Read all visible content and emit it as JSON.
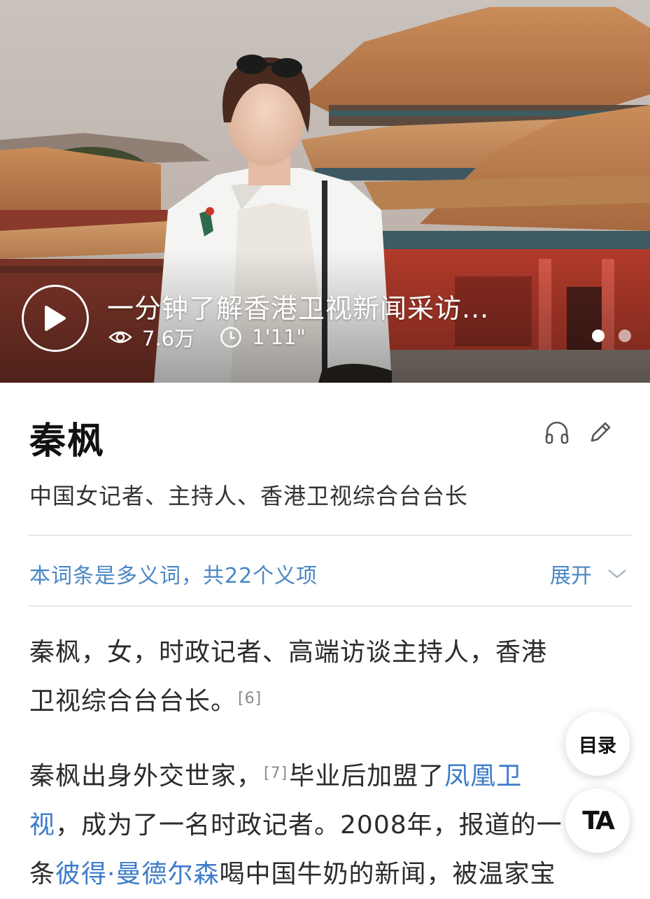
{
  "video": {
    "title": "一分钟了解香港卫视新闻采访...",
    "views": "7.6万",
    "duration": "1'11\"",
    "slide_count": 2,
    "active_slide": 1
  },
  "entry": {
    "title": "秦枫",
    "subtitle": "中国女记者、主持人、香港卫视综合台台长",
    "polysemy_text": "本词条是多义词，共22个义项",
    "expand_label": "展开"
  },
  "paragraphs": {
    "p1": {
      "text_a": "秦枫，女，时政记者、高端访谈主持人，香港",
      "text_b": "卫视综合台台长。",
      "ref": "[6]"
    },
    "p2": {
      "text_a": "秦枫出身外交世家，",
      "ref": "[7]",
      "text_b": "毕业后加盟了",
      "link1": "凤凰卫",
      "link1b": "视",
      "text_c": "，成为了一名时政记者。2008年，报道的一",
      "text_d": "条",
      "link2": "彼得·曼德尔森",
      "text_e": "喝中国牛奶的新闻，被温家宝"
    }
  },
  "floating": {
    "toc_label": "目录",
    "ta_label": "TA"
  },
  "colors": {
    "link": "#3d7cc9",
    "accent": "#4a86c5",
    "divider": "#e8e8e8"
  },
  "icons": [
    "play-icon",
    "eye-icon",
    "clock-icon",
    "headphones-icon",
    "pencil-icon",
    "chevron-down-icon"
  ]
}
